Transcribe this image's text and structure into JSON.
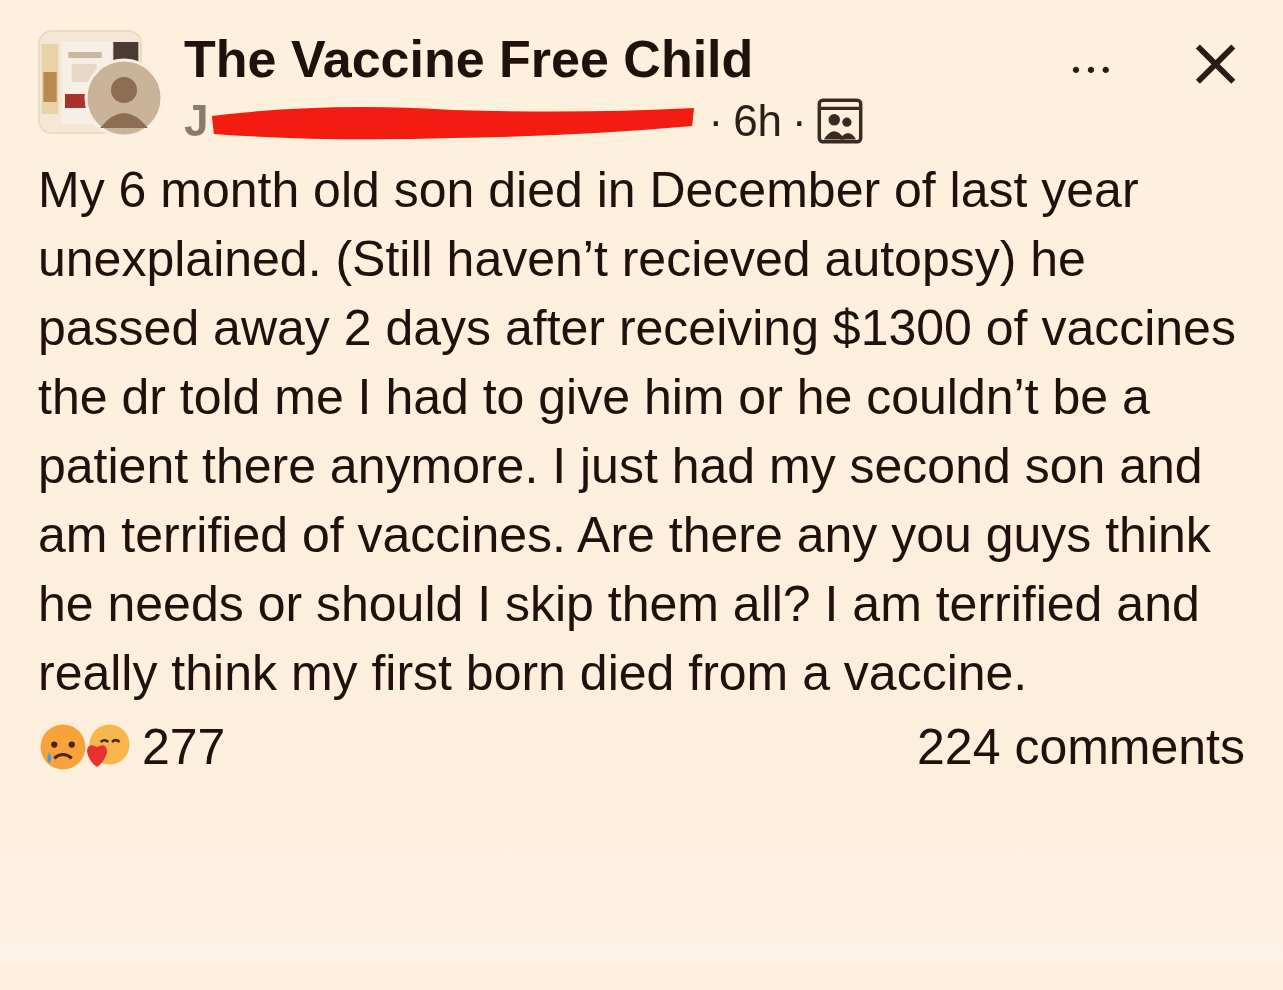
{
  "post": {
    "group_name": "The Vaccine Free Child",
    "author": {
      "text": "J",
      "redacted": true
    },
    "separator_1": "·",
    "time": "6h",
    "separator_2": "·",
    "more_button": "•••",
    "close_button": "×",
    "body": "My 6 month old son died in December of last year unexplained. (Still haven’t recieved autopsy) he passed away 2 days after receiving $1300 of vaccines the dr told me I had to give him or he couldn’t be a patient there anymore. I just had my second son and am terrified of vaccines. Are there any you guys think he needs or should I skip them all? I am terrified and really think my first born died from a vaccine.",
    "reaction_count": "277",
    "comments": "224 comments"
  }
}
